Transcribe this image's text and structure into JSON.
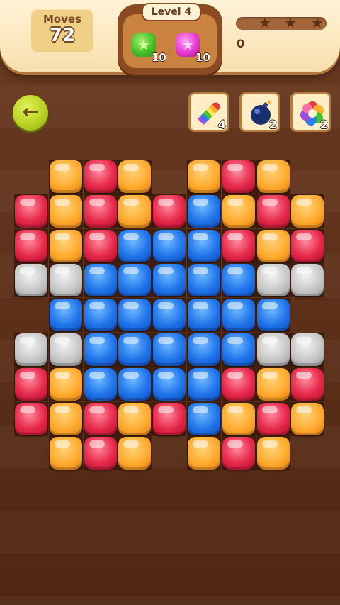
{
  "header": {
    "moves_label": "Moves",
    "moves_value": "72",
    "level_label": "Level 4",
    "goals": [
      {
        "name": "green-star-gem",
        "color": "#46c22a",
        "count": "10"
      },
      {
        "name": "pink-star-gem",
        "color": "#e63bcf",
        "count": "10"
      }
    ],
    "score": "0",
    "stars_earned": 0,
    "stars_total": 3
  },
  "controls": {
    "back_icon": "back-arrow-icon"
  },
  "boosters": [
    {
      "name": "rocket-booster",
      "icon": "rainbow-rocket-icon",
      "count": "4"
    },
    {
      "name": "bomb-booster",
      "icon": "bomb-icon",
      "count": "2"
    },
    {
      "name": "color-swirl-booster",
      "icon": "rainbow-swirl-icon",
      "count": "2"
    }
  ],
  "colors": {
    "O": "#ffab2f",
    "R": "#e62849",
    "B": "#1f74ea",
    "G": "#c8c8c8"
  },
  "board": [
    ".OROEORO.",
    "RORORBORO",
    "RORBBBROR",
    "GGBBBBBGG",
    ".BBBBBBB.",
    "GGBBBBBGG",
    "ROBBBBROR",
    "RORORBORO",
    ".OROEORO."
  ]
}
